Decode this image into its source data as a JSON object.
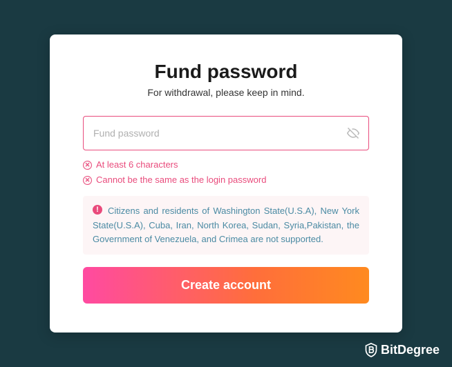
{
  "card": {
    "title": "Fund password",
    "subtitle": "For withdrawal, please keep in mind.",
    "input": {
      "placeholder": "Fund password",
      "value": ""
    },
    "validation": {
      "rule1": "At least 6 characters",
      "rule2": "Cannot be the same as the login password"
    },
    "notice": "Citizens and residents of Washington State(U.S.A), New York State(U.S.A), Cuba, Iran, North Korea, Sudan, Syria,Pakistan, the Government of Venezuela, and Crimea are not supported.",
    "submit_label": "Create account"
  },
  "brand": {
    "name": "BitDegree"
  }
}
